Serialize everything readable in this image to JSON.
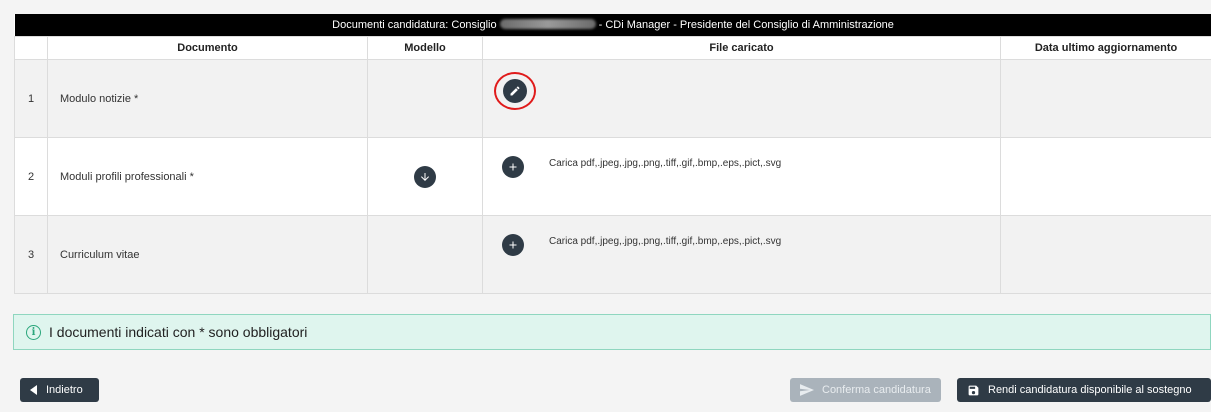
{
  "table": {
    "caption_prefix": "Documenti candidatura: Consiglio",
    "caption_suffix": "- CDi Manager - Presidente del Consiglio di Amministrazione",
    "headers": {
      "number": "",
      "document": "Documento",
      "model": "Modello",
      "file": "File caricato",
      "date": "Data ultimo aggiornamento"
    },
    "rows": [
      {
        "number": "1",
        "document": "Modulo notizie *",
        "file_hint": "",
        "date": ""
      },
      {
        "number": "2",
        "document": "Moduli profili professionali *",
        "file_hint": "Carica pdf,.jpeg,.jpg,.png,.tiff,.gif,.bmp,.eps,.pict,.svg",
        "date": ""
      },
      {
        "number": "3",
        "document": "Curriculum vitae",
        "file_hint": "Carica pdf,.jpeg,.jpg,.png,.tiff,.gif,.bmp,.eps,.pict,.svg",
        "date": ""
      }
    ]
  },
  "notice": {
    "icon": "info-icon",
    "text": "I documenti indicati con * sono obbligatori"
  },
  "buttons": {
    "back": "Indietro",
    "confirm": "Conferma candidatura",
    "available": "Rendi candidatura disponibile al sostegno"
  },
  "colors": {
    "primary": "#2f3b46",
    "disabled": "#aab3bb",
    "highlight_ring": "#e01b1b",
    "notice_bg": "#dff5ee",
    "notice_border": "#8fd6bf",
    "caption_bg": "#000000"
  }
}
